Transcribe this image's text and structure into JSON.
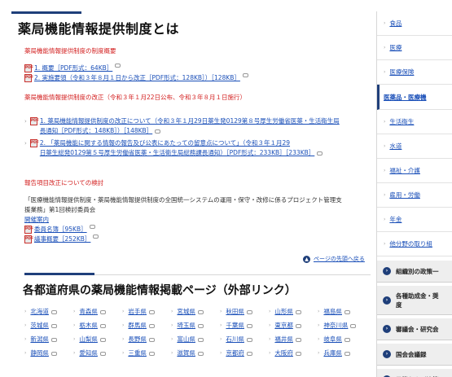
{
  "main": {
    "title": "薬局機能情報提供制度とは",
    "section1": {
      "heading": "薬局機能情報提供制度の制度概要",
      "docs": [
        {
          "label": "1. 概要［PDF形式：64KB］",
          "icon": "pdf-icon"
        },
        {
          "label": "2. 実施要領（令和３年８月１日から改正［PDF形式：128KB］）［128KB］",
          "icon": "pdf-icon"
        }
      ]
    },
    "section2": {
      "heading": "薬局機能情報提供制度の改正（令和３年１月22日公布、令和３年８月１日施行）",
      "docs": [
        {
          "line1": "1. 薬局機能情報提供制度の改正について（令和３年１月29日薬生発0129第８号厚生労働省医薬・生活衛生局",
          "line2": "長通知［PDF形式：148KB］）［148KB］"
        },
        {
          "line1": "2. 「薬局機能に関する情報の報告及び公表にあたっての留意点について」（令和３年１月29",
          "line2": "日薬生総発0129第５号厚生労働省医薬・生活衛生局総務課長通知）［PDF形式：233KB］［233KB］"
        }
      ]
    },
    "section3": {
      "heading": "報告項目改正についての検討",
      "body1": "「医療機能情報提供制度・薬局機能情報提供制度の全国統一システムの運用・保守・改修に係るプロジェクト管理支",
      "body2": "援業務」第1回検討委員会",
      "link_open": "開催案内",
      "docs": [
        "委員名簿［95KB］",
        "議事概要［252KB］"
      ]
    },
    "pagetop_label": "ページの先頭へ戻る",
    "title2": "各都道府県の薬局機能情報掲載ページ（外部リンク）",
    "prefectures": [
      "北海道",
      "青森県",
      "岩手県",
      "宮城県",
      "秋田県",
      "山形県",
      "福島県",
      "茨城県",
      "栃木県",
      "群馬県",
      "埼玉県",
      "千葉県",
      "東京都",
      "神奈川県",
      "新潟県",
      "山梨県",
      "長野県",
      "富山県",
      "石川県",
      "福井県",
      "岐阜県",
      "静岡県",
      "愛知県",
      "三重県",
      "滋賀県",
      "京都府",
      "大阪府",
      "兵庫県"
    ]
  },
  "sidebar": {
    "items": [
      {
        "label": "食品",
        "active": false
      },
      {
        "label": "医療",
        "active": false
      },
      {
        "label": "医療保険",
        "active": false
      },
      {
        "label": "医薬品・医療機",
        "active": true
      },
      {
        "label": "生活衛生",
        "active": false
      },
      {
        "label": "水道",
        "active": false
      },
      {
        "label": "福祉・介護",
        "active": false
      },
      {
        "label": "雇用・労働",
        "active": false
      },
      {
        "label": "年金",
        "active": false
      },
      {
        "label": "他分野の取り組",
        "active": false
      }
    ],
    "dark_items": [
      {
        "label": "組織別の政策一"
      },
      {
        "label1": "各種助成金・奨",
        "label2": "度"
      },
      {
        "label": "審議会・研究会"
      },
      {
        "label": "国会会議録"
      },
      {
        "label": "予算および決算"
      }
    ]
  },
  "colors": {
    "accent_navy": "#1f3f7a",
    "link_blue": "#1a4fb8",
    "heading_red": "#d32020"
  }
}
